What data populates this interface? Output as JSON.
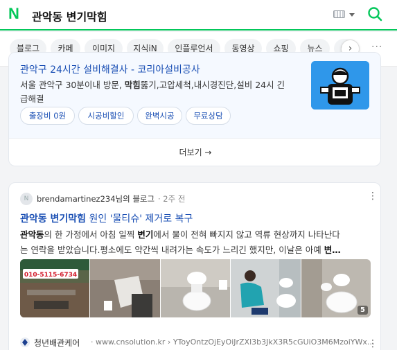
{
  "header": {
    "logo": "N",
    "query": "관악동 변기막힘"
  },
  "tabs": [
    "블로그",
    "카페",
    "이미지",
    "지식iN",
    "인플루언서",
    "동영상",
    "쇼핑",
    "뉴스",
    "어"
  ],
  "ad": {
    "title": "관악구 24시간 설비해결사 - 코리아설비공사",
    "desc_line1_pre": "서울 관악구 30분이내 방문, ",
    "desc_line1_bold": "막힘",
    "desc_line1_post": "뚫기,고압세척,내시경진단,설비 24시 긴",
    "desc_line2": "급해결",
    "chips": [
      "출장비 0원",
      "시공비할인",
      "완벽시공",
      "무료상담"
    ],
    "more_label": "더보기 →"
  },
  "blog": {
    "author": "brendamartinez234님의 블로그",
    "time": "· 2주 전",
    "title_bold": "관악동 변기막힘",
    "title_rest": " 원인 '물티슈' 제거로 복구",
    "snip1_b": "관악동",
    "snip1_a": "의 한 가정에서 아침 일찍 ",
    "snip1_b2": "변기",
    "snip1_c": "에서 물이 전혀 빠지지 않고 역류 현상까지 나타난다",
    "snip2_a": "는 연락을 받았습니다.평소에도 약간씩 내려가는 속도가 느리긴 했지만, 이날은 아예 ",
    "snip2_b": "변…",
    "thumb_phone": "010-5115-6734",
    "thumb_count": "5"
  },
  "next": {
    "site": "청년배관케어",
    "url": "· www.cnsolution.kr › YToyOntzOjEyOiJrZXl3b3JkX3R5cGUiO3M6MzoiYWx..."
  },
  "colors": {
    "brand": "#03c75a",
    "link": "#1a4fb4",
    "card_bg": "#f5f9ff"
  }
}
